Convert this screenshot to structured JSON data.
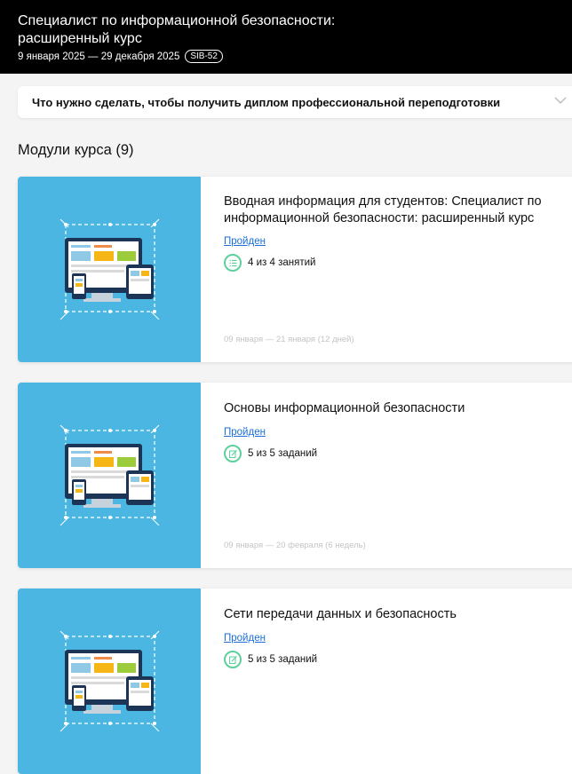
{
  "header": {
    "title": "Специалист по информационной безопасности: расширенный курс",
    "dates": "9 января 2025 — 29 декабря 2025",
    "code": "SIB-52"
  },
  "diploma": {
    "label": "Что нужно сделать, чтобы получить диплом профессиональной переподготовки"
  },
  "modules": {
    "heading": "Модули курса (9)",
    "items": [
      {
        "title": "Вводная информация для студентов: Специалист по информационной безопасности: расширенный курс",
        "status": "Пройден",
        "progress": "4 из 4 занятий",
        "progress_icon": "list-icon",
        "dates": "09 января — 21 января (12 дней)"
      },
      {
        "title": "Основы информационной безопасности",
        "status": "Пройден",
        "progress": "5 из 5 заданий",
        "progress_icon": "edit-icon",
        "dates": "09 января — 20 февраля (6 недель)"
      },
      {
        "title": "Сети передачи данных и безопасность",
        "status": "Пройден",
        "progress": "5 из 5 заданий",
        "progress_icon": "edit-icon"
      }
    ]
  },
  "colors": {
    "header_bg": "#000000",
    "thumb_bg": "#4ab6e1",
    "link": "#1b6fd8",
    "progress_ring": "#5fcf9c"
  }
}
